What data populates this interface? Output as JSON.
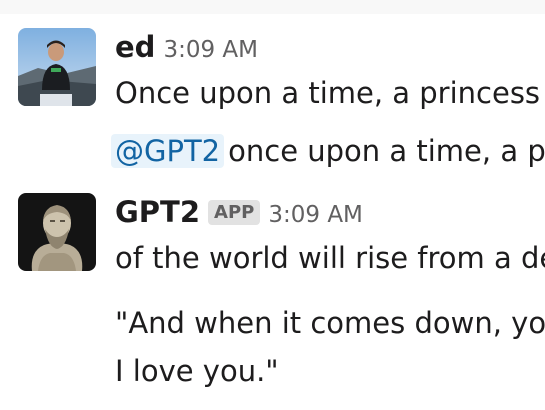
{
  "messages": [
    {
      "author": "ed",
      "time": "3:09 AM",
      "avatar": "user-photo-avatar",
      "lines": [
        "Once upon a time, a princess"
      ]
    },
    {
      "mention": "@GPT2",
      "text": "once upon a time, a p"
    },
    {
      "author": "GPT2",
      "badge": "APP",
      "time": "3:09 AM",
      "avatar": "statue-bust-avatar",
      "lines": [
        "of the world will rise from a de",
        "\"And when it comes down, you",
        "I love you.\""
      ]
    }
  ],
  "colors": {
    "mention_bg": "#e8f3fb",
    "mention_text": "#1264a3",
    "timestamp": "#616061",
    "badge_bg": "#e2e2e2"
  }
}
